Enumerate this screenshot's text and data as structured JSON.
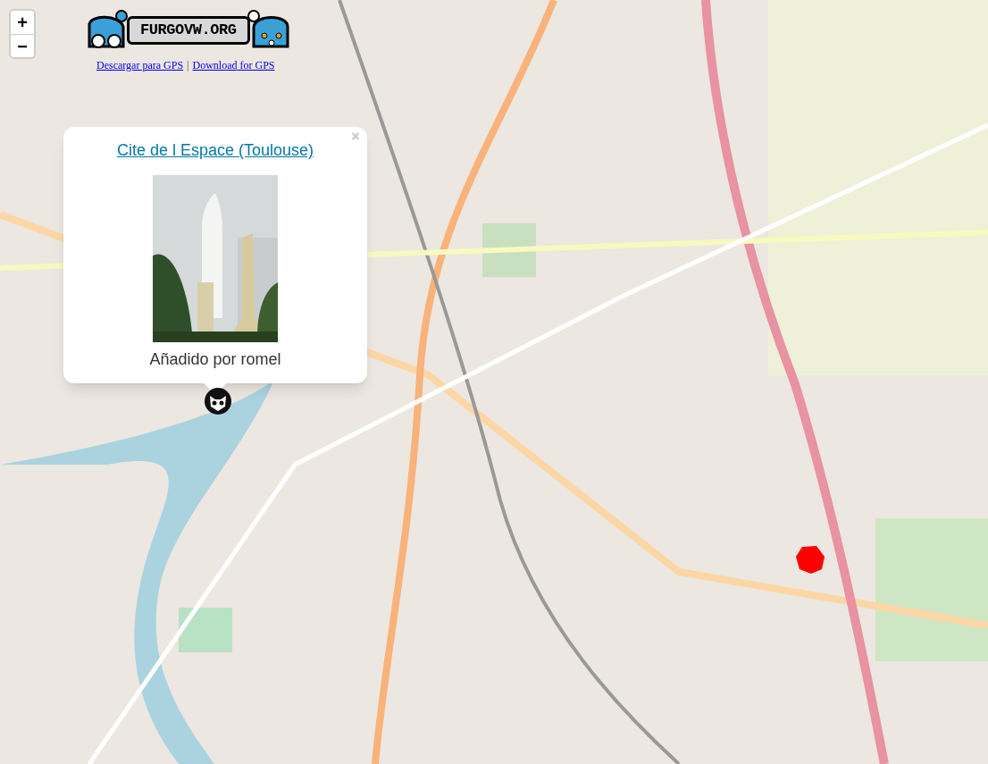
{
  "zoom_controls": [
    "+",
    "−"
  ],
  "logo": {
    "text": "FURGOVW.ORG"
  },
  "download_links": [
    "Descargar para GPS",
    "Download for GPS"
  ],
  "link_separator": "|",
  "popup": {
    "close": "×",
    "title": "Cite de l Espace (Toulouse)",
    "caption": "Añadido por romel"
  }
}
